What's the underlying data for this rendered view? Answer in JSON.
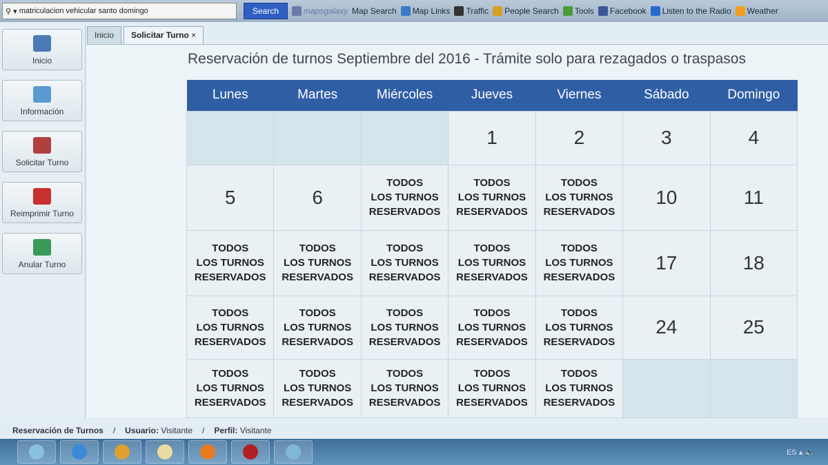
{
  "toolbar": {
    "search_value": "matriculacion vehicular santo domingo",
    "search_label": "Search",
    "links": [
      {
        "label": "mapsgalaxy",
        "icon": "mapsgalaxy-logo-icon",
        "color": "#6a7aa8"
      },
      {
        "label": "Map Search",
        "icon": "",
        "color": ""
      },
      {
        "label": "Map Links",
        "icon": "map-icon",
        "color": "#3a7ac8"
      },
      {
        "label": "Traffic",
        "icon": "traffic-light-icon",
        "color": "#333"
      },
      {
        "label": "People Search",
        "icon": "magnifier-icon",
        "color": "#d8a020"
      },
      {
        "label": "Tools",
        "icon": "gear-icon",
        "color": "#4a9a3a"
      },
      {
        "label": "Facebook",
        "icon": "facebook-icon",
        "color": "#3b5998"
      },
      {
        "label": "Listen to the Radio",
        "icon": "play-icon",
        "color": "#2a6ad0"
      },
      {
        "label": "Weather",
        "icon": "weather-icon",
        "color": "#f0a020"
      }
    ]
  },
  "tabs": [
    {
      "label": "Inicio"
    },
    {
      "label": "Solicitar Turno",
      "close": "×"
    }
  ],
  "sidebar": [
    {
      "label": "Inicio",
      "icon": "home-icon",
      "color": "#4a7ab8"
    },
    {
      "label": "Información",
      "icon": "users-icon",
      "color": "#5a9ad0"
    },
    {
      "label": "Solicitar Turno",
      "icon": "calendar-icon",
      "color": "#b04040"
    },
    {
      "label": "Reimprimir Turno",
      "icon": "pdf-icon",
      "color": "#c83030"
    },
    {
      "label": "Anular Turno",
      "icon": "cancel-icon",
      "color": "#3a9a5a"
    }
  ],
  "title": "Reservación de turnos Septiembre del 2016 - Trámite solo para rezagados o traspasos",
  "calendar": {
    "days": [
      "Lunes",
      "Martes",
      "Miércoles",
      "Jueves",
      "Viernes",
      "Sábado",
      "Domingo"
    ],
    "reserved_text": "TODOS\nLOS TURNOS\nRESERVADOS",
    "weeks": [
      [
        null,
        null,
        null,
        "1",
        "2",
        "3",
        "4"
      ],
      [
        "5",
        "6",
        "R",
        "R",
        "R",
        "10",
        "11"
      ],
      [
        "R",
        "R",
        "R",
        "R",
        "R",
        "17",
        "18"
      ],
      [
        "R",
        "R",
        "R",
        "R",
        "R",
        "24",
        "25"
      ],
      [
        "R",
        "R",
        "R",
        "R",
        "R",
        null,
        null
      ]
    ]
  },
  "status": {
    "section": "Reservación de Turnos",
    "user_label": "Usuario:",
    "user": "Visitante",
    "profile_label": "Perfil:",
    "profile": "Visitante"
  },
  "taskbar": {
    "apps": [
      {
        "icon": "start-orb-icon",
        "color": "#8ac0e0"
      },
      {
        "icon": "internet-explorer-icon",
        "color": "#3a8ad8"
      },
      {
        "icon": "media-player-icon",
        "color": "#e0a030"
      },
      {
        "icon": "file-explorer-icon",
        "color": "#e8dca0"
      },
      {
        "icon": "firefox-icon",
        "color": "#e87a20"
      },
      {
        "icon": "acrobat-icon",
        "color": "#b02020"
      },
      {
        "icon": "image-viewer-icon",
        "color": "#80b8d8"
      }
    ],
    "lang": "ES"
  }
}
